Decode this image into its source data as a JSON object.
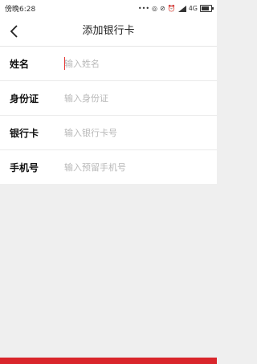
{
  "status": {
    "time": "傍晚6:28",
    "network": "4G",
    "icons": [
      "more-dots-icon",
      "target-icon",
      "mute-icon",
      "alarm-icon",
      "signal-icon",
      "battery-icon"
    ]
  },
  "header": {
    "title": "添加银行卡",
    "back_icon": "chevron-left-icon"
  },
  "form": {
    "fields": [
      {
        "label": "姓名",
        "placeholder": "输入姓名",
        "value": ""
      },
      {
        "label": "身份证",
        "placeholder": "输入身份证",
        "value": ""
      },
      {
        "label": "银行卡",
        "placeholder": "输入银行卡号",
        "value": ""
      },
      {
        "label": "手机号",
        "placeholder": "输入预留手机号",
        "value": ""
      }
    ]
  },
  "colors": {
    "accent": "#d9252b",
    "background": "#efefef",
    "placeholder": "#b8b8b8"
  }
}
